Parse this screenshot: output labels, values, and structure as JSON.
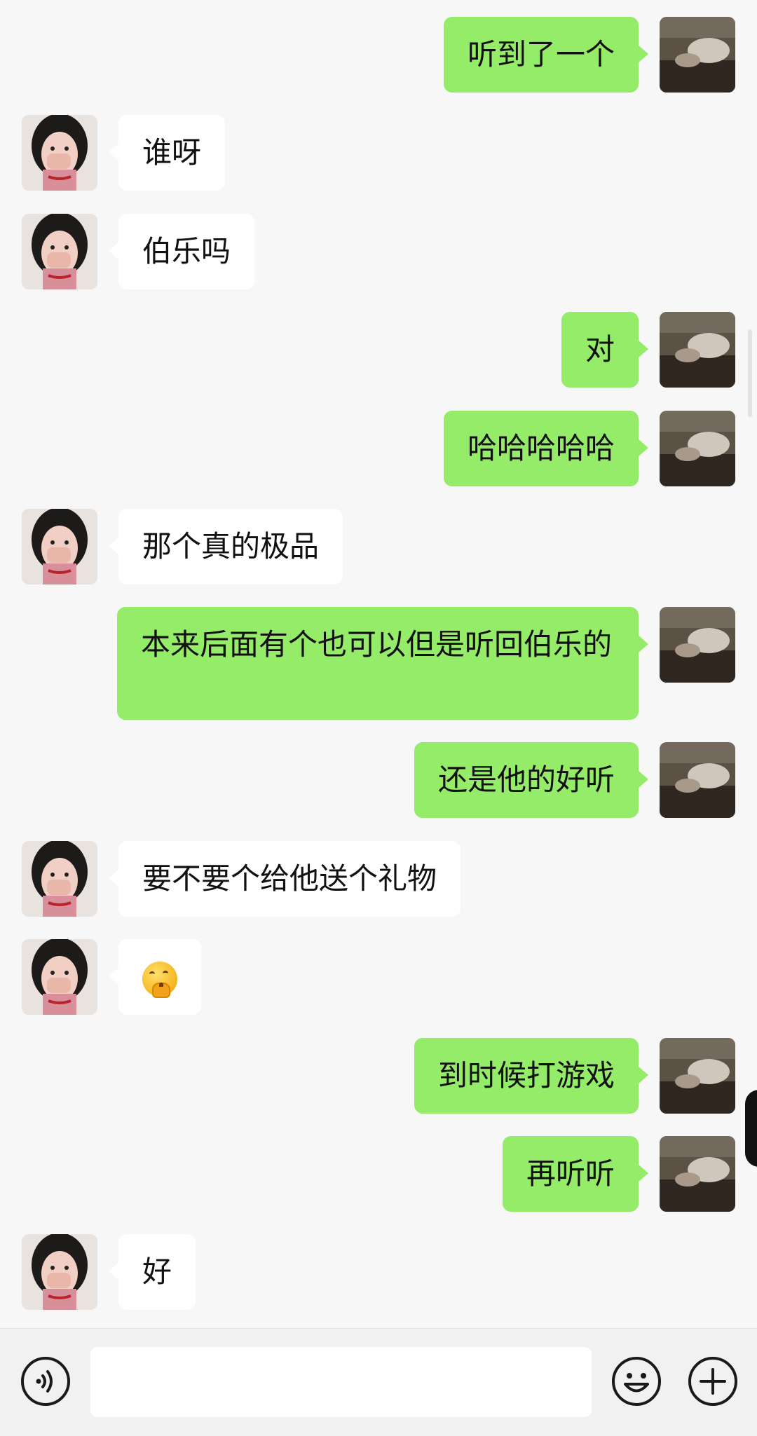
{
  "messages": [
    {
      "side": "right",
      "text": "听到了一个"
    },
    {
      "side": "left",
      "text": "谁呀"
    },
    {
      "side": "left",
      "text": "伯乐吗"
    },
    {
      "side": "right",
      "text": "对"
    },
    {
      "side": "right",
      "text": "哈哈哈哈哈"
    },
    {
      "side": "left",
      "text": "那个真的极品"
    },
    {
      "side": "right",
      "text": "本来后面有个也可以但是听回伯乐的"
    },
    {
      "side": "right",
      "text": "还是他的好听"
    },
    {
      "side": "left",
      "text": "要不要个给他送个礼物"
    },
    {
      "side": "left",
      "text": "",
      "emoji": "thinking-face"
    },
    {
      "side": "right",
      "text": "到时候打游戏"
    },
    {
      "side": "right",
      "text": "再听听"
    },
    {
      "side": "left",
      "text": "好"
    }
  ],
  "toolbar": {
    "voice_icon": "voice-icon",
    "input_value": "",
    "emoji_icon": "smiley-icon",
    "more_icon": "plus-icon"
  },
  "colors": {
    "sent_bubble": "#95ec69",
    "received_bubble": "#ffffff",
    "background": "#f7f7f7"
  }
}
